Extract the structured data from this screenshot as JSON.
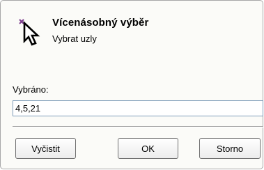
{
  "dialog": {
    "title": "Vícenásobný výběr",
    "subtitle": "Vybrat uzly",
    "icon": "cursor-arrow-with-x-icon"
  },
  "selection": {
    "label": "Vybráno:",
    "value": "4,5,21"
  },
  "buttons": {
    "clear": "Vyčistit",
    "ok": "OK",
    "cancel": "Storno"
  }
}
